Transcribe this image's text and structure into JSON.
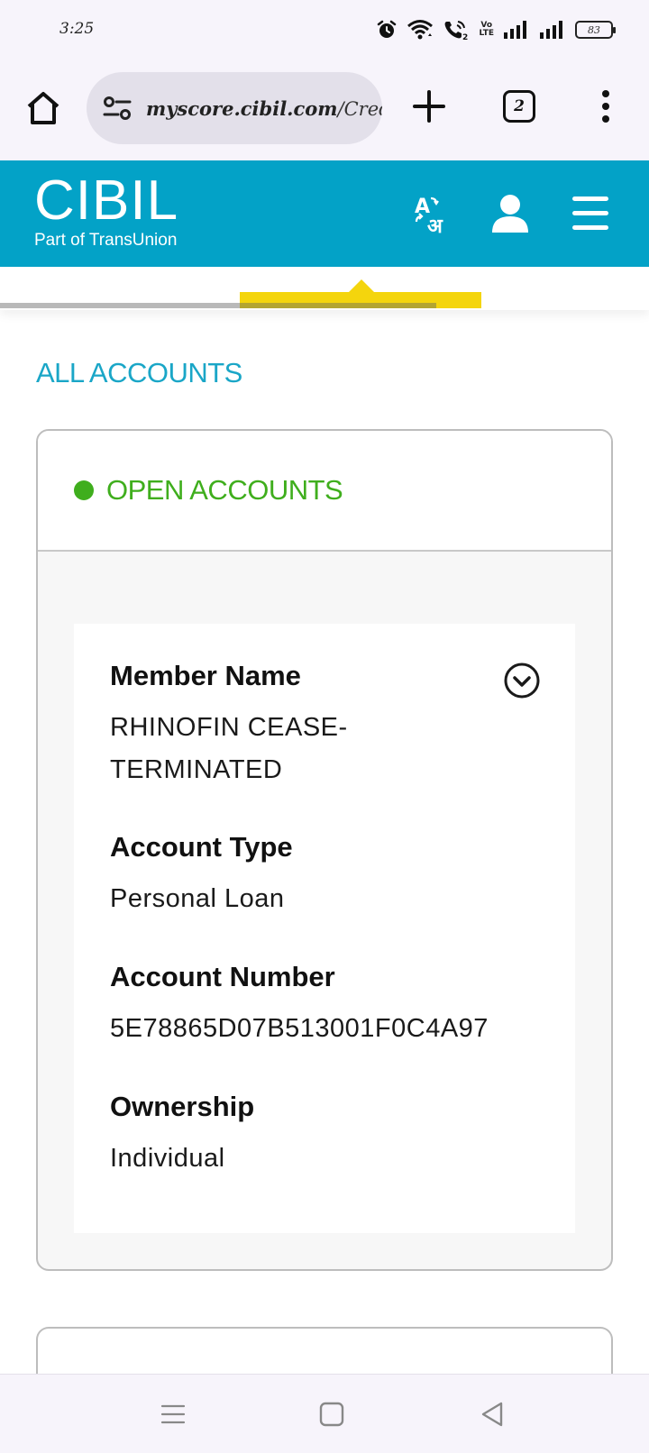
{
  "status_bar": {
    "time": "3:25",
    "battery_level": "83",
    "volte_label_top": "Vo",
    "volte_label_bottom": "LTE"
  },
  "browser": {
    "url_domain": "myscore.cibil.com",
    "url_path": "/Cred",
    "tabs_count": "2"
  },
  "header": {
    "logo": "CIBIL",
    "tagline": "Part of TransUnion",
    "brand_color": "#03a2c7"
  },
  "progress": {
    "accent_color": "#f4d50d"
  },
  "main": {
    "section_title": "ALL ACCOUNTS",
    "group_label": "OPEN ACCOUNTS",
    "group_status_color": "#3fae1d",
    "account": {
      "member_name_label": "Member Name",
      "member_name_line1": "RHINOFIN CEASE-",
      "member_name_line2": "TERMINATED",
      "account_type_label": "Account Type",
      "account_type": "Personal Loan",
      "account_number_label": "Account Number",
      "account_number": "5E78865D07B513001F0C4A97",
      "ownership_label": "Ownership",
      "ownership": "Individual"
    }
  },
  "icons": {
    "alarm": "alarm-icon",
    "wifi": "wifi-icon",
    "wifi_calling": "wifi-calling-icon",
    "signal": "signal-icon",
    "home": "home-icon",
    "site_settings": "tune-icon",
    "new_tab": "plus-icon",
    "more": "more-vertical-icon",
    "translate": "translate-icon",
    "profile": "user-icon",
    "menu": "hamburger-icon",
    "expand": "chevron-down-circle-icon"
  }
}
